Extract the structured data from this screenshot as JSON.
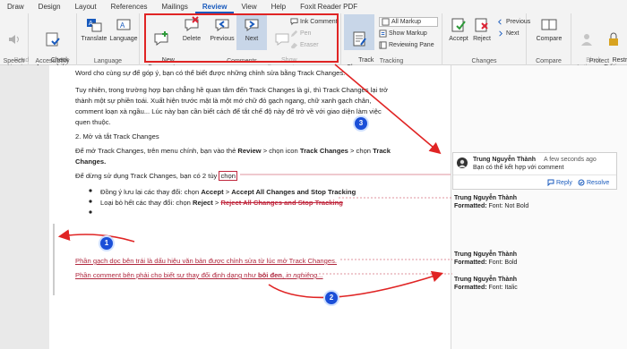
{
  "tabs": [
    "Draw",
    "Design",
    "Layout",
    "References",
    "Mailings",
    "Review",
    "View",
    "Help",
    "Foxit Reader PDF"
  ],
  "ribbon": {
    "read_aloud": "Read\nAloud",
    "check_accessibility": "Check\nAccessibility",
    "translate": "Translate",
    "language": "Language",
    "new_comment": "New\nComment",
    "delete": "Delete",
    "previous": "Previous",
    "next": "Next",
    "show_comments": "Show\nComments",
    "ink_comment": "Ink Comment",
    "pen": "Pen",
    "eraser": "Eraser",
    "track_changes": "Track\nChanges",
    "all_markup": "All Markup",
    "show_markup": "Show Markup",
    "reviewing_pane": "Reviewing Pane",
    "accept": "Accept",
    "reject": "Reject",
    "previous_change": "Previous",
    "next_change": "Next",
    "compare": "Compare",
    "block_authors": "Block\nAuthors",
    "restrict_editing": "Restrict\nEditing",
    "groups": {
      "speech": "Speech",
      "accessibility": "Accessibility",
      "language": "Language",
      "comments": "Comments",
      "tracking": "Tracking",
      "changes": "Changes",
      "compare": "Compare",
      "protect": "Protect"
    }
  },
  "document": {
    "line1": "Word cho cùng sự để góp ý, bạn có thể biết được những chỉnh sửa bằng Track Changes.",
    "p2a": "Tuy nhiên, trong trường hợp bạn chẳng hề quan tâm đến Track Changes là gì, thì Track Changes lại trở",
    "p2b": "thành một sự phiền toái. Xuất hiện trước mặt là một mớ chữ đỏ gạch ngang, chữ xanh gạch chân,",
    "p2c": "comment loạn xà ngầu... Lúc này bạn cần biết cách để tắt chế độ này để trở về với giao diện làm việc",
    "p2d": "quen thuộc.",
    "heading": "2. Mở và tắt Track Changes",
    "p3a_pre": "Để mở Track Changes, trên menu chính, bạn vào thẻ ",
    "p3a_review": "Review",
    "p3a_mid": " > chọn icon ",
    "p3a_tc": "Track Changes",
    "p3a_mid2": " > chọn ",
    "p3a_tc2": "Track",
    "p3b": "Changes.",
    "p4_pre": "Để dừng sử dụng Track Changes, bạn có 2 tùy ",
    "p4_sel": "chọn",
    "b1_pre": "Đồng ý lưu lại các thay đổi: chọn ",
    "b1_accept": "Accept",
    "b1_mid": " > ",
    "b1_all": "Accept All Changes and Stop Tracking",
    "b2_pre": "Loại bỏ hết các thay đổi: chọn ",
    "b2_reject": "Reject",
    "b2_mid": " > ",
    "b2_all": "Reject All Changes and Stop Tracking",
    "red1": "Phần gạch dọc bên trái là dấu hiệu văn bản được chỉnh sửa từ lúc mở Track Changes.",
    "red2_pre": "Phần comment bên phải cho biết sự thay đổi định dạng như ",
    "red2_bold": "bôi đen",
    "red2_mid": ", ",
    "red2_italic": "in nghiêng..."
  },
  "comment": {
    "author": "Trung Nguyễn Thành",
    "time": "A few seconds ago",
    "text": "Bạn có thể kết hợp với comment",
    "reply": "Reply",
    "resolve": "Resolve"
  },
  "formats": [
    {
      "author": "Trung Nguyễn Thành",
      "label": "Formatted:",
      "value": "Font: Not Bold"
    },
    {
      "author": "Trung Nguyễn Thành",
      "label": "Formatted:",
      "value": "Font: Bold"
    },
    {
      "author": "Trung Nguyễn Thành",
      "label": "Formatted:",
      "value": "Font: Italic"
    }
  ],
  "badges": [
    "1",
    "2",
    "3"
  ],
  "colors": {
    "accent": "#185abd",
    "highlight_box": "#e02424",
    "arrow": "#e02424",
    "badge": "#1b4fd8",
    "revision": "#b0283e"
  }
}
